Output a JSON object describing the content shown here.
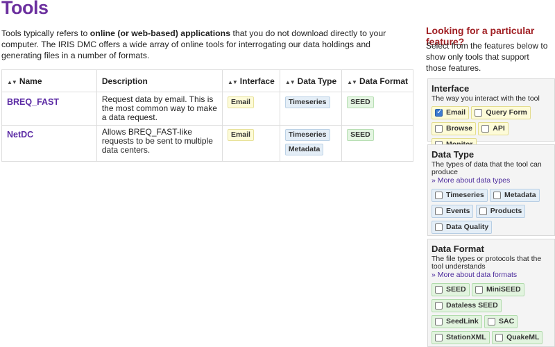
{
  "page": {
    "title": "Tools",
    "intro_pre": "Tools typically refers to ",
    "intro_bold": "online (or web-based) applications",
    "intro_post": " that you do not download directly to your computer. The IRIS DMC offers a wide array of online tools for interrogating our data holdings and generating files in a number of formats."
  },
  "table": {
    "headers": [
      "Name",
      "Description",
      "Interface",
      "Data Type",
      "Data Format"
    ],
    "rows": [
      {
        "name": "BREQ_FAST",
        "description": "Request data by email. This is the most common way to make a data request.",
        "interface": [
          "Email"
        ],
        "data_type": [
          "Timeseries"
        ],
        "data_format": [
          "SEED"
        ]
      },
      {
        "name": "NetDC",
        "description": "Allows BREQ_FAST-like requests to be sent to multiple data centers.",
        "interface": [
          "Email"
        ],
        "data_type": [
          "Timeseries",
          "Metadata"
        ],
        "data_format": [
          "SEED"
        ]
      }
    ]
  },
  "sidebar": {
    "heading": "Looking for a particular feature?",
    "subtext": "Select from the features below to show only tools that support those features.",
    "panels": {
      "interface": {
        "title": "Interface",
        "desc": "The way you interact with the tool",
        "options": [
          {
            "label": "Email",
            "checked": true
          },
          {
            "label": "Query Form",
            "checked": false
          },
          {
            "label": "Browse",
            "checked": false
          },
          {
            "label": "API",
            "checked": false
          },
          {
            "label": "Monitor",
            "checked": false
          }
        ]
      },
      "data_type": {
        "title": "Data Type",
        "desc": "The types of data that the tool can produce",
        "more": "» More about data types",
        "options": [
          {
            "label": "Timeseries",
            "checked": false
          },
          {
            "label": "Metadata",
            "checked": false
          },
          {
            "label": "Events",
            "checked": false
          },
          {
            "label": "Products",
            "checked": false
          },
          {
            "label": "Data Quality",
            "checked": false
          }
        ]
      },
      "data_format": {
        "title": "Data Format",
        "desc": "The file types or protocols that the tool understands",
        "more": "» More about data formats",
        "options": [
          {
            "label": "SEED",
            "checked": false
          },
          {
            "label": "MiniSEED",
            "checked": false
          },
          {
            "label": "Dataless SEED",
            "checked": false
          },
          {
            "label": "SeedLink",
            "checked": false
          },
          {
            "label": "SAC",
            "checked": false
          },
          {
            "label": "StationXML",
            "checked": false
          },
          {
            "label": "QuakeML",
            "checked": false
          }
        ]
      }
    }
  },
  "icons": {
    "sort": "sort-arrows-icon",
    "checkbox": "checkbox-icon"
  },
  "colors": {
    "title": "#6b2f9e",
    "link": "#5b2aa4",
    "side_heading": "#a01f23"
  }
}
